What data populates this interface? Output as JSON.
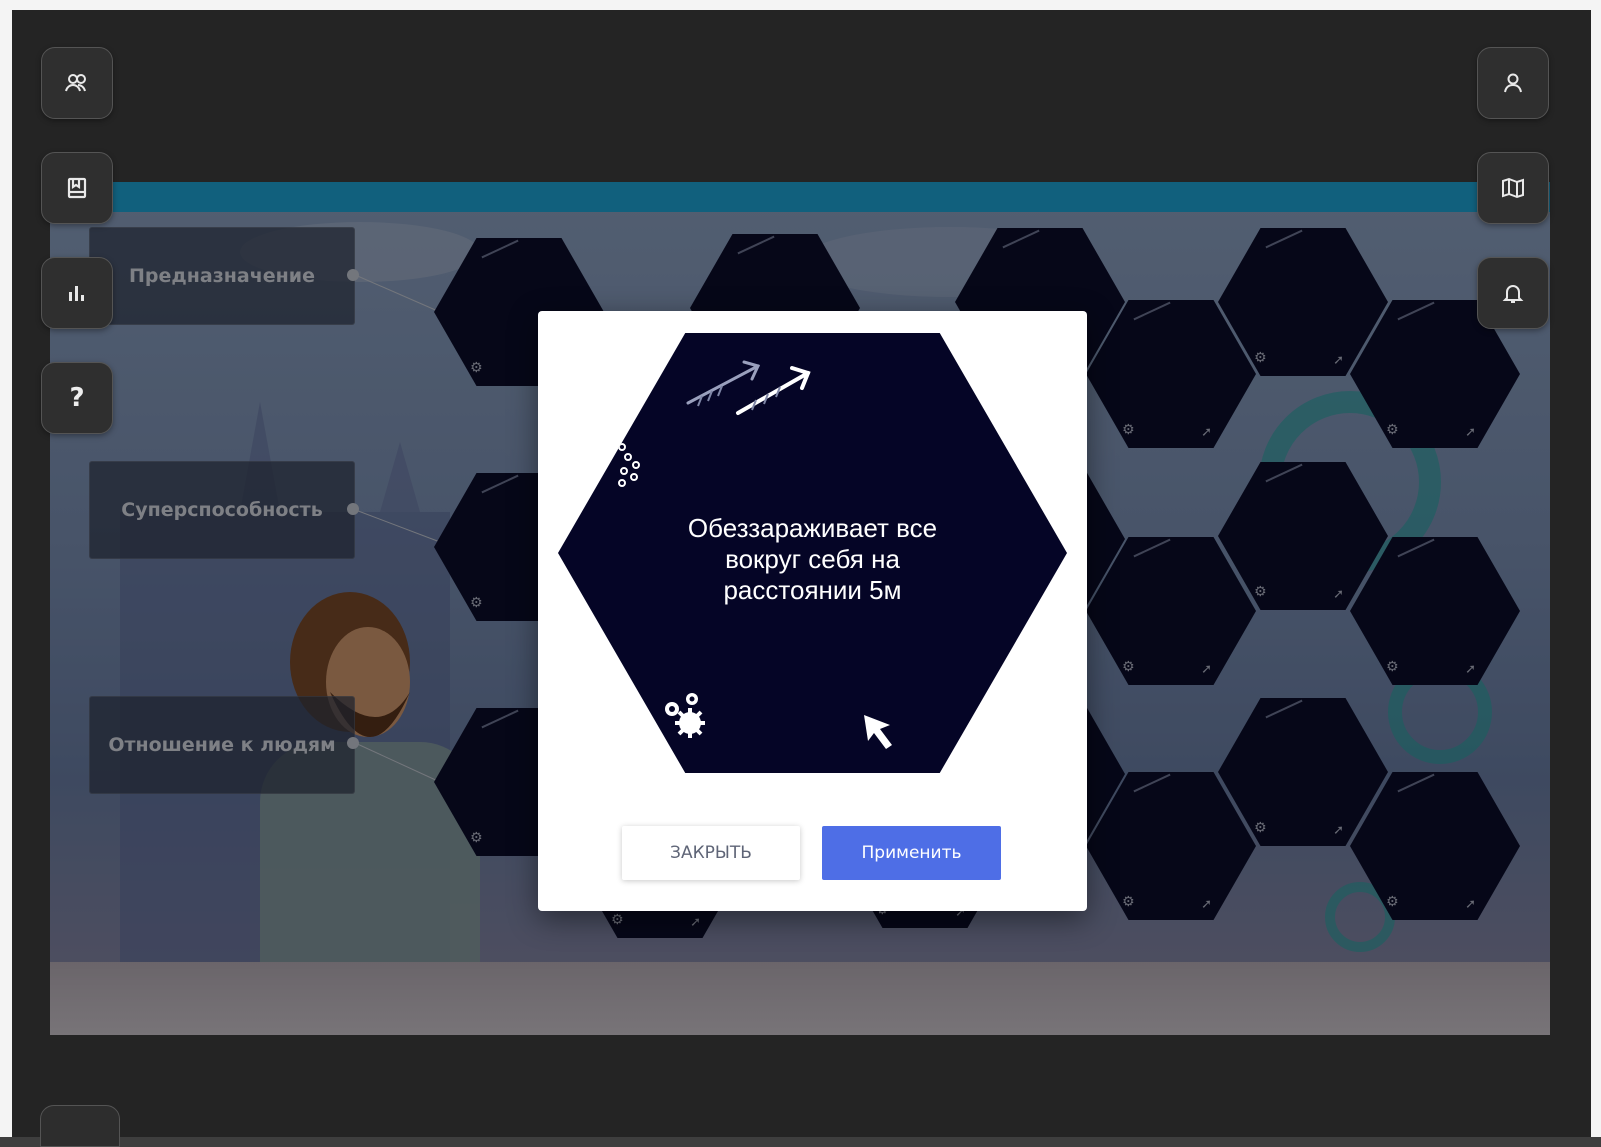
{
  "left_toolbar": [
    {
      "name": "team-icon"
    },
    {
      "name": "book-icon"
    },
    {
      "name": "chart-icon"
    },
    {
      "name": "help-icon",
      "label": "?"
    }
  ],
  "right_toolbar": [
    {
      "name": "user-icon"
    },
    {
      "name": "map-icon"
    },
    {
      "name": "bell-icon"
    }
  ],
  "labels": {
    "purpose": "Предназначение",
    "superpower": "Суперспособность",
    "attitude": "Отношение к людям"
  },
  "modal": {
    "card_text": "Обеззараживает все вокруг себя на расстоянии 5м",
    "close_label": "ЗАКРЫТЬ",
    "apply_label": "Применить"
  },
  "colors": {
    "apply_button": "#4e6ee6",
    "card_background": "#050526",
    "scene_top_bar": "#1ea5d8"
  }
}
